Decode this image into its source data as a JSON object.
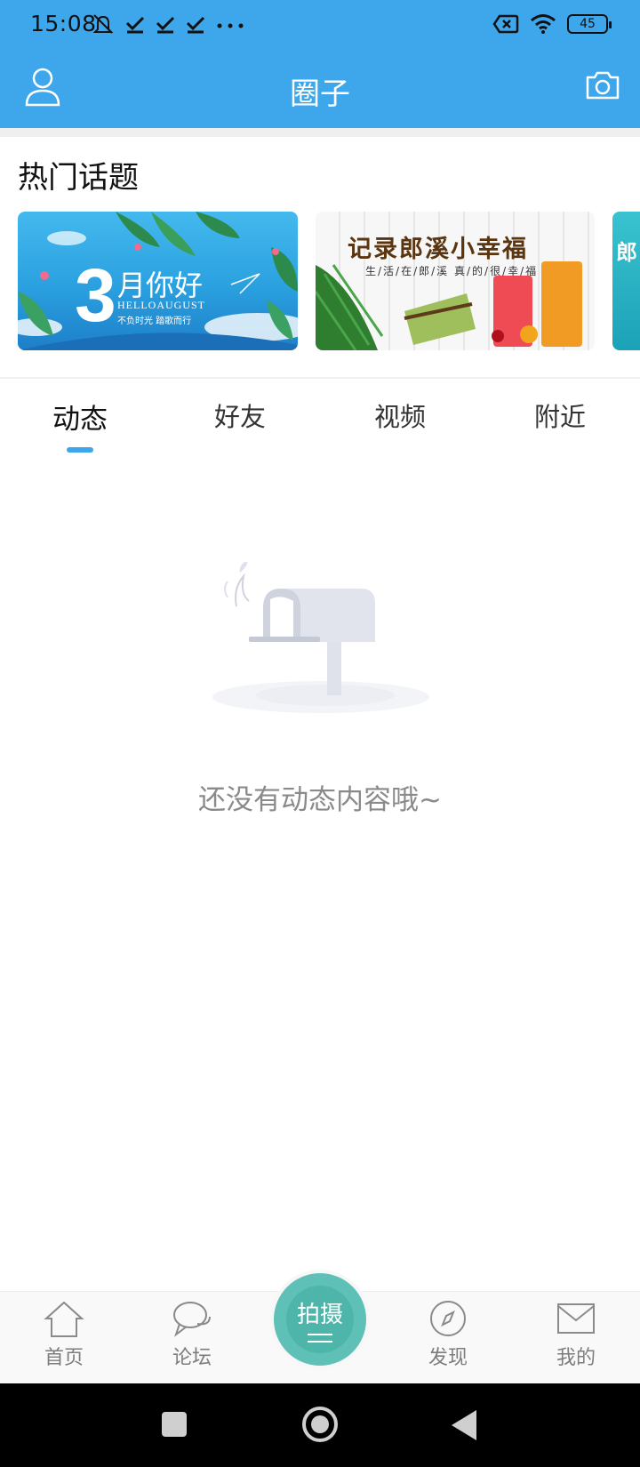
{
  "status_bar": {
    "time": "15:08",
    "battery": "45",
    "icons": [
      "mute-icon",
      "check-icon",
      "check-icon",
      "check-icon",
      "more-dots-icon",
      "sim-off-icon",
      "wifi-icon",
      "battery-icon"
    ]
  },
  "header": {
    "title": "圈子",
    "left_icon": "user-icon",
    "right_icon": "camera-icon",
    "color": "#3ea6ea"
  },
  "hot_topics": {
    "title": "热门话题",
    "banners": [
      {
        "number": "3",
        "main": "月你好",
        "sub": "HELLOAUGUST",
        "sub2": "不负时光  踏歌而行"
      },
      {
        "title": "记录郎溪小幸福",
        "sub": "生/活/在/郎/溪 真/的/很/幸/福"
      },
      {
        "title": "郎"
      }
    ]
  },
  "tabs": {
    "items": [
      {
        "label": "动态",
        "active": true
      },
      {
        "label": "好友",
        "active": false
      },
      {
        "label": "视频",
        "active": false
      },
      {
        "label": "附近",
        "active": false
      }
    ]
  },
  "empty_state": {
    "message": "还没有动态内容哦~"
  },
  "bottom_nav": {
    "items": [
      {
        "label": "首页",
        "icon": "home-icon"
      },
      {
        "label": "论坛",
        "icon": "chat-icon"
      },
      {
        "label": "拍摄",
        "icon": "shoot-icon"
      },
      {
        "label": "发现",
        "icon": "compass-icon"
      },
      {
        "label": "我的",
        "icon": "mail-icon"
      }
    ],
    "accent": "#4eb5aa"
  }
}
